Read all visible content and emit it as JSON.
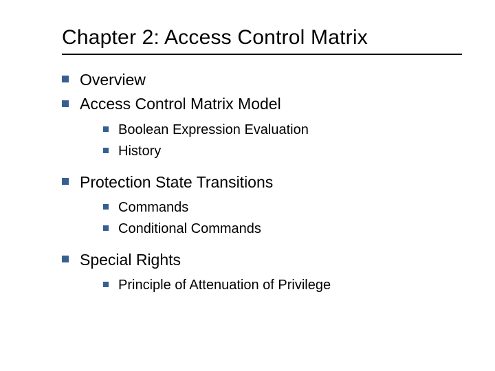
{
  "title": "Chapter 2: Access Control Matrix",
  "items": [
    {
      "label": "Overview",
      "children": []
    },
    {
      "label": "Access Control Matrix Model",
      "children": [
        {
          "label": "Boolean Expression Evaluation"
        },
        {
          "label": "History"
        }
      ]
    },
    {
      "label": "Protection State Transitions",
      "children": [
        {
          "label": "Commands"
        },
        {
          "label": "Conditional Commands"
        }
      ]
    },
    {
      "label": "Special Rights",
      "children": [
        {
          "label": "Principle of Attenuation of Privilege"
        }
      ]
    }
  ]
}
